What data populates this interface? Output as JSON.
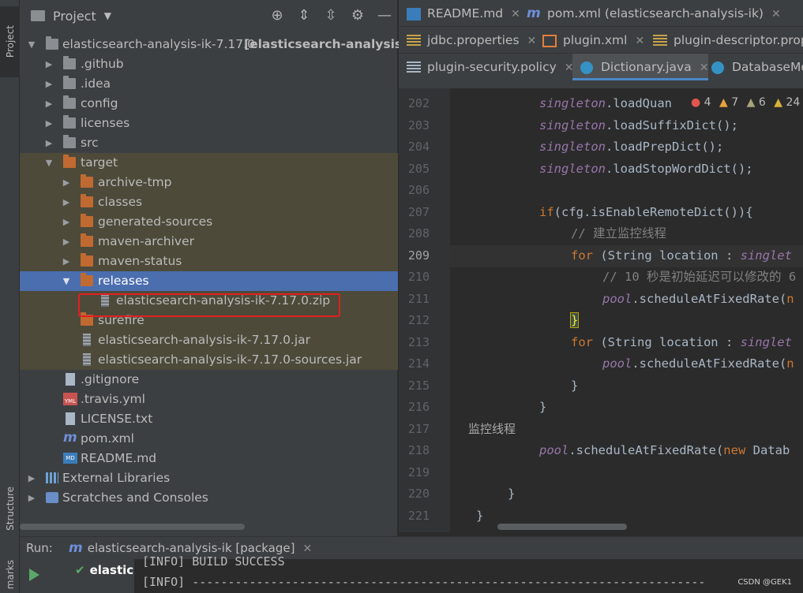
{
  "sidebar": {
    "project_tab": "Project",
    "structure_tab": "Structure",
    "marks_tab": "marks"
  },
  "project_panel": {
    "title": "Project",
    "tree": [
      {
        "label": "elasticsearch-analysis-ik-7.17.0",
        "suffix": "[elasticsearch-analysis-ik]",
        "depth": 0,
        "expanded": true,
        "icon": "module-folder-icon"
      },
      {
        "label": ".github",
        "depth": 1,
        "expanded": false,
        "icon": "folder-icon"
      },
      {
        "label": ".idea",
        "depth": 1,
        "expanded": false,
        "icon": "folder-icon"
      },
      {
        "label": "config",
        "depth": 1,
        "expanded": false,
        "icon": "folder-icon"
      },
      {
        "label": "licenses",
        "depth": 1,
        "expanded": false,
        "icon": "folder-icon"
      },
      {
        "label": "src",
        "depth": 1,
        "expanded": false,
        "icon": "folder-icon"
      },
      {
        "label": "target",
        "depth": 1,
        "expanded": true,
        "icon": "excluded-folder-icon"
      },
      {
        "label": "archive-tmp",
        "depth": 2,
        "expanded": false,
        "icon": "excluded-folder-icon"
      },
      {
        "label": "classes",
        "depth": 2,
        "expanded": false,
        "icon": "excluded-folder-icon"
      },
      {
        "label": "generated-sources",
        "depth": 2,
        "expanded": false,
        "icon": "excluded-folder-icon"
      },
      {
        "label": "maven-archiver",
        "depth": 2,
        "expanded": false,
        "icon": "excluded-folder-icon"
      },
      {
        "label": "maven-status",
        "depth": 2,
        "expanded": false,
        "icon": "excluded-folder-icon"
      },
      {
        "label": "releases",
        "depth": 2,
        "expanded": true,
        "icon": "excluded-folder-icon"
      },
      {
        "label": "elasticsearch-analysis-ik-7.17.0.zip",
        "depth": 3,
        "icon": "zip-file-icon"
      },
      {
        "label": "surefire",
        "depth": 2,
        "icon": "excluded-folder-icon"
      },
      {
        "label": "elasticsearch-analysis-ik-7.17.0.jar",
        "depth": 2,
        "icon": "zip-file-icon"
      },
      {
        "label": "elasticsearch-analysis-ik-7.17.0-sources.jar",
        "depth": 2,
        "icon": "zip-file-icon"
      },
      {
        "label": ".gitignore",
        "depth": 1,
        "icon": "file-icon"
      },
      {
        "label": ".travis.yml",
        "depth": 1,
        "icon": "yml-file-icon"
      },
      {
        "label": "LICENSE.txt",
        "depth": 1,
        "icon": "text-file-icon"
      },
      {
        "label": "pom.xml",
        "depth": 1,
        "icon": "maven-icon"
      },
      {
        "label": "README.md",
        "depth": 1,
        "icon": "markdown-file-icon"
      },
      {
        "label": "External Libraries",
        "depth": 0,
        "expanded": false,
        "icon": "libraries-icon"
      },
      {
        "label": "Scratches and Consoles",
        "depth": 0,
        "expanded": false,
        "icon": "scratches-icon"
      }
    ]
  },
  "editor": {
    "tabs_row1": [
      {
        "label": "README.md",
        "icon": "markdown-file-icon"
      },
      {
        "label": "pom.xml (elasticsearch-analysis-ik)",
        "icon": "maven-icon"
      }
    ],
    "tabs_row2": [
      {
        "label": "jdbc.properties",
        "icon": "properties-file-icon"
      },
      {
        "label": "plugin.xml",
        "icon": "xml-file-icon"
      },
      {
        "label": "plugin-descriptor.prop",
        "icon": "properties-file-icon"
      }
    ],
    "tabs_row3": [
      {
        "label": "plugin-security.policy",
        "icon": "policy-file-icon"
      },
      {
        "label": "Dictionary.java",
        "icon": "java-class-icon",
        "active": true
      },
      {
        "label": "DatabaseMo",
        "icon": "java-class-icon"
      }
    ],
    "inspections": {
      "errors": "4",
      "warnings": "7",
      "weak_warnings": "6",
      "typos": "24"
    },
    "lines": [
      {
        "num": "202",
        "text": "singleton.loadQuan"
      },
      {
        "num": "203",
        "text": "singleton.loadSuffixDict();"
      },
      {
        "num": "204",
        "text": "singleton.loadPrepDict();"
      },
      {
        "num": "205",
        "text": "singleton.loadStopWordDict();"
      },
      {
        "num": "206",
        "text": ""
      },
      {
        "num": "207",
        "text": "if(cfg.isEnableRemoteDict()){"
      },
      {
        "num": "208",
        "text": "// 建立监控线程"
      },
      {
        "num": "209",
        "text": "for (String location : singlet"
      },
      {
        "num": "210",
        "text": "// 10 秒是初始延迟可以修改的 6"
      },
      {
        "num": "211",
        "text": "pool.scheduleAtFixedRate(n"
      },
      {
        "num": "212",
        "text": "}"
      },
      {
        "num": "213",
        "text": "for (String location : singlet"
      },
      {
        "num": "214",
        "text": "pool.scheduleAtFixedRate(n"
      },
      {
        "num": "215",
        "text": "}"
      },
      {
        "num": "216",
        "text": "}"
      },
      {
        "num": "217",
        "text": "监控线程"
      },
      {
        "num": "218",
        "text": "pool.scheduleAtFixedRate(new Datab"
      },
      {
        "num": "219",
        "text": ""
      },
      {
        "num": "220",
        "text": "}"
      },
      {
        "num": "221",
        "text": "}"
      }
    ],
    "current_line": "209"
  },
  "run_panel": {
    "label": "Run:",
    "tab": "elasticsearch-analysis-ik [package]",
    "tree_item": "elastic",
    "console": [
      "[INFO] BUILD SUCCESS",
      "[INFO] ------------------------------------------------------------------------"
    ]
  },
  "watermark": "CSDN @GEK1",
  "colors": {
    "selection": "#4b6eaf",
    "excluded_bg": "#4d4a3a",
    "highlight_box": "#e02020",
    "keyword": "#cc7832",
    "field": "#9876aa"
  }
}
